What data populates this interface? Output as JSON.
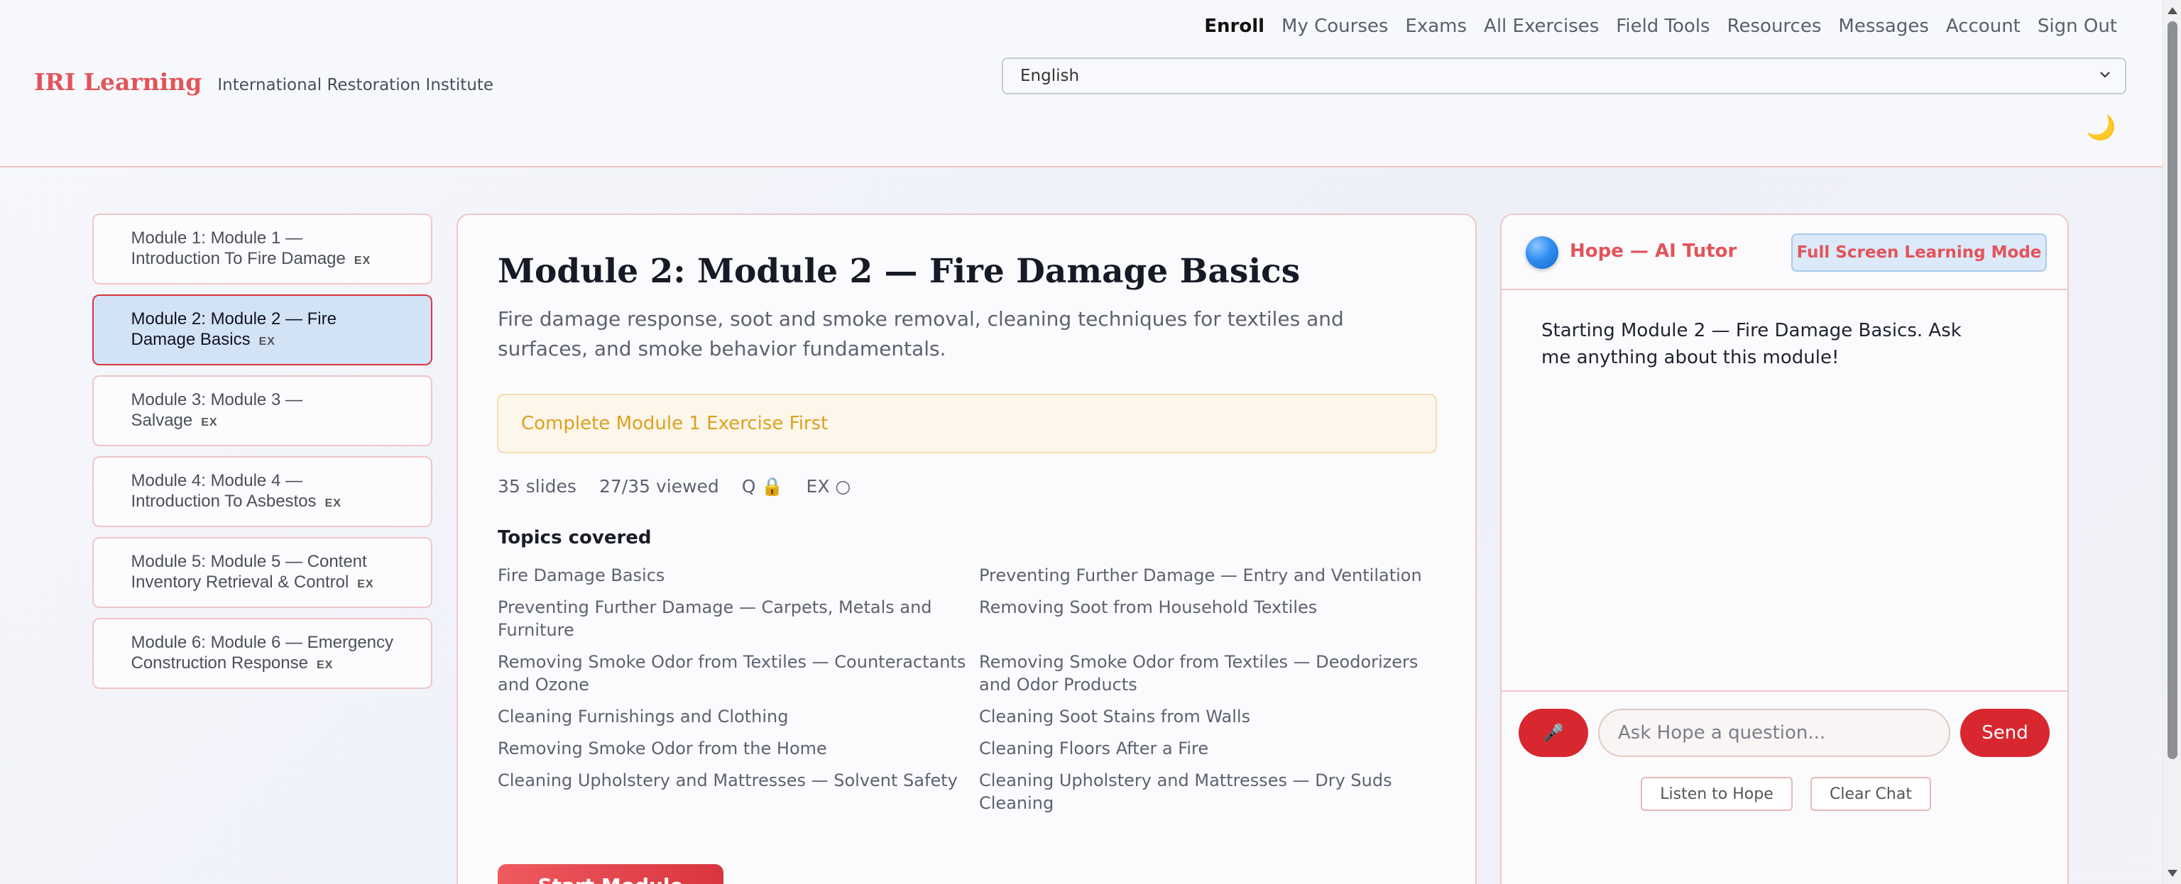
{
  "header": {
    "brand": "IRI Learning",
    "subtitle": "International Restoration Institute",
    "nav": [
      {
        "label": "Enroll",
        "active": true
      },
      {
        "label": "My Courses"
      },
      {
        "label": "Exams"
      },
      {
        "label": "All Exercises"
      },
      {
        "label": "Field Tools"
      },
      {
        "label": "Resources"
      },
      {
        "label": "Messages"
      },
      {
        "label": "Account"
      },
      {
        "label": "Sign Out"
      }
    ],
    "language": "English",
    "theme_icon": "🌙"
  },
  "sidebar": {
    "modules": [
      {
        "label": "Module 1: Module 1 — Introduction To Fire Damage",
        "badge": "EX"
      },
      {
        "label": "Module 2: Module 2 — Fire Damage Basics",
        "badge": "EX",
        "active": true
      },
      {
        "label": "Module 3: Module 3 — Salvage",
        "badge": "EX"
      },
      {
        "label": "Module 4: Module 4 — Introduction To Asbestos",
        "badge": "EX"
      },
      {
        "label": "Module 5: Module 5 — Content Inventory Retrieval & Control",
        "badge": "EX"
      },
      {
        "label": "Module 6: Module 6 — Emergency Construction Response",
        "badge": "EX"
      }
    ]
  },
  "main": {
    "title": "Module 2: Module 2 — Fire Damage Basics",
    "description": "Fire damage response, soot and smoke removal, cleaning techniques for textiles and surfaces, and smoke behavior fundamentals.",
    "notice": "Complete Module 1 Exercise First",
    "stats": {
      "slides": "35 slides",
      "viewed": "27/35 viewed",
      "quiz": "Q 🔒",
      "exercise": "EX ○"
    },
    "topics_title": "Topics covered",
    "topics": [
      "Fire Damage Basics",
      "Preventing Further Damage — Entry and Ventilation",
      "Preventing Further Damage — Carpets, Metals and Furniture",
      "Removing Soot from Household Textiles",
      "Removing Smoke Odor from Textiles — Counteractants and Ozone",
      "Removing Smoke Odor from Textiles — Deodorizers and Odor Products",
      "Cleaning Furnishings and Clothing",
      "Cleaning Soot Stains from Walls",
      "Removing Smoke Odor from the Home",
      "Cleaning Floors After a Fire",
      "Cleaning Upholstery and Mattresses — Solvent Safety",
      "Cleaning Upholstery and Mattresses — Dry Suds Cleaning"
    ],
    "start_button": "Start Module"
  },
  "tutor": {
    "name": "Hope — AI Tutor",
    "fullscreen_label": "Full Screen Learning Mode",
    "message": "Starting Module 2 — Fire Damage Basics. Ask me anything about this module!",
    "mic_icon": "🎤",
    "input_placeholder": "Ask Hope a question...",
    "send_label": "Send",
    "listen_label": "Listen to Hope",
    "clear_label": "Clear Chat"
  }
}
